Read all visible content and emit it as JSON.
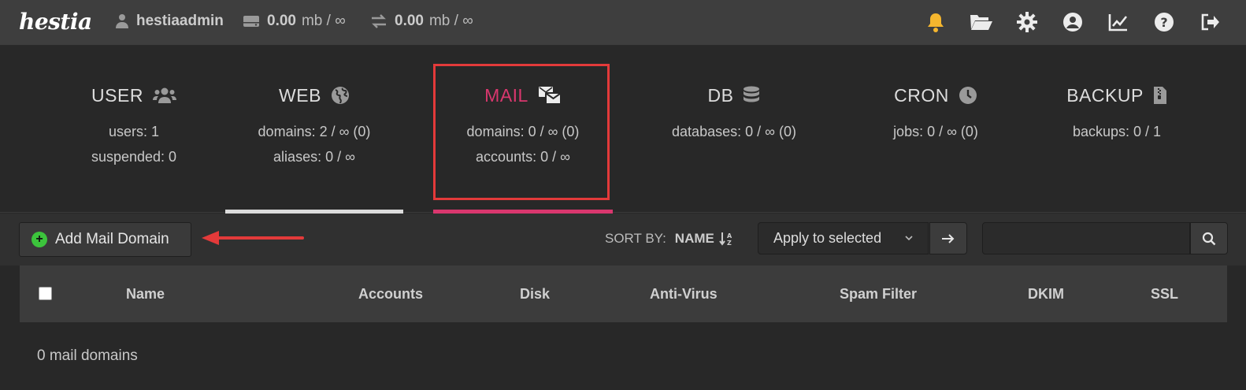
{
  "app": {
    "logo_text": "hestia"
  },
  "topbar": {
    "username": "hestiaadmin",
    "disk_value": "0.00",
    "disk_unit": "mb / ∞",
    "bandwidth_value": "0.00",
    "bandwidth_unit": "mb / ∞",
    "icons": [
      "bell-icon",
      "folder-open-icon",
      "gear-icon",
      "user-circle-icon",
      "chart-line-icon",
      "question-circle-icon",
      "logout-icon"
    ],
    "bell_color": "#f5b62e"
  },
  "tabs": [
    {
      "label": "USER",
      "icon": "users-icon",
      "lines": [
        "users: 1",
        "suspended: 0"
      ]
    },
    {
      "label": "WEB",
      "icon": "globe-icon",
      "lines": [
        "domains: 2 / ∞ (0)",
        "aliases: 0 / ∞"
      ]
    },
    {
      "label": "MAIL",
      "icon": "mail-icon",
      "lines": [
        "domains: 0 / ∞ (0)",
        "accounts: 0 / ∞"
      ],
      "active": true
    },
    {
      "label": "DB",
      "icon": "database-icon",
      "lines": [
        "databases: 0 / ∞ (0)"
      ]
    },
    {
      "label": "CRON",
      "icon": "clock-icon",
      "lines": [
        "jobs: 0 / ∞ (0)"
      ]
    },
    {
      "label": "BACKUP",
      "icon": "file-zip-icon",
      "lines": [
        "backups: 0 / 1"
      ]
    }
  ],
  "colors": {
    "accent": "#d9376e",
    "highlight": "#e33a3a",
    "hover_bar": "#dcdcdc",
    "add_icon": "#3cc43c"
  },
  "toolbar": {
    "add_label": "Add Mail Domain",
    "sort_label": "SORT BY:",
    "sort_value": "NAME",
    "bulk_select": "Apply to selected",
    "search_placeholder": ""
  },
  "table": {
    "columns": [
      "Name",
      "Accounts",
      "Disk",
      "Anti-Virus",
      "Spam Filter",
      "DKIM",
      "SSL"
    ],
    "footer": "0 mail domains"
  }
}
